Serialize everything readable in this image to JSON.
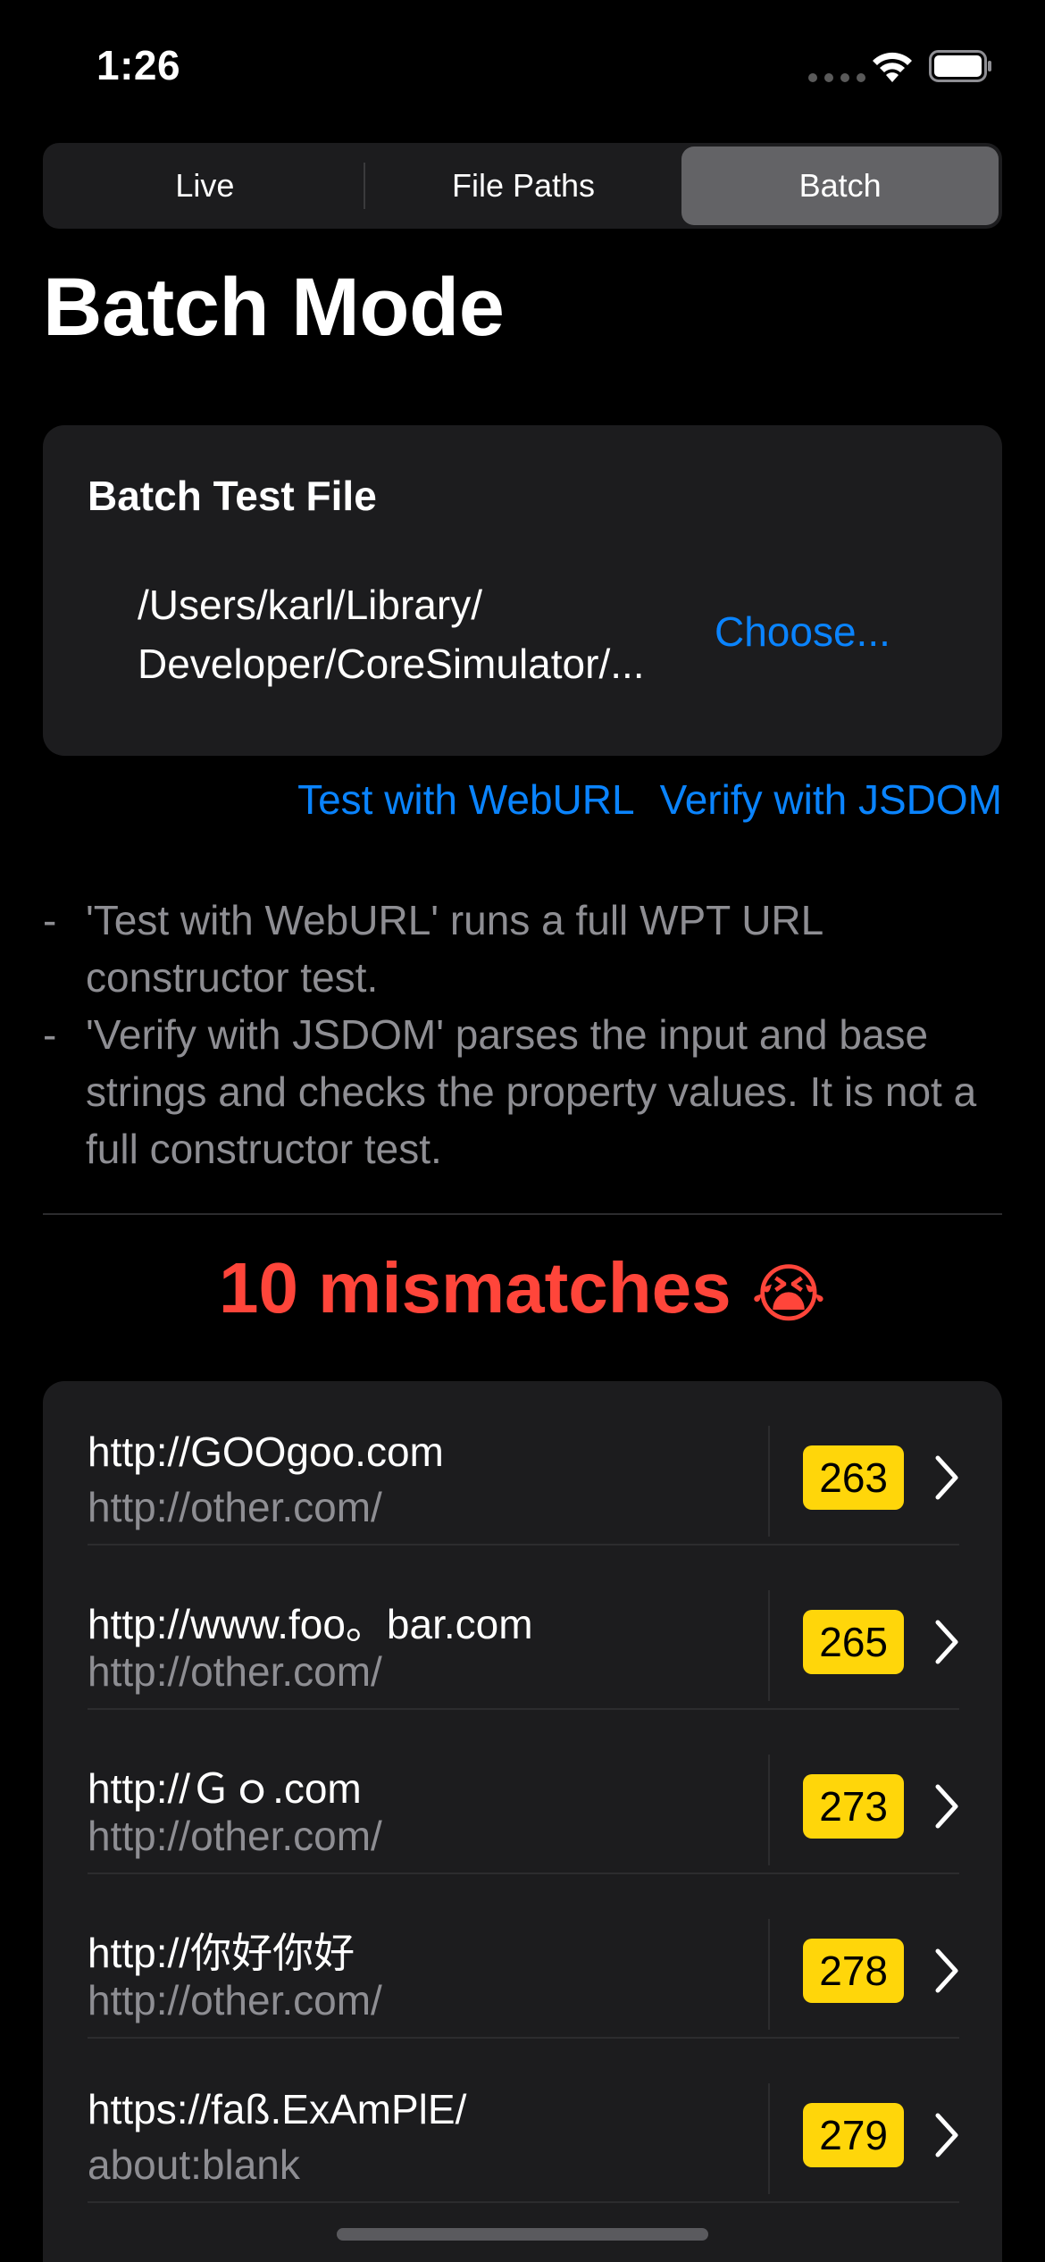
{
  "status_bar": {
    "time": "1:26"
  },
  "tabs": [
    {
      "label": "Live",
      "selected": false
    },
    {
      "label": "File Paths",
      "selected": false
    },
    {
      "label": "Batch",
      "selected": true
    }
  ],
  "page_title": "Batch Mode",
  "batch_card": {
    "title": "Batch Test File",
    "file_path": "/Users/karl/Library/\nDeveloper/CoreSimulator/...",
    "choose_label": "Choose..."
  },
  "actions": {
    "test_webur_label": "Test with WebURL",
    "verify_jsdom_label": "Verify with JSDOM"
  },
  "notes": [
    "'Test with WebURL' runs a full WPT URL constructor test.",
    "'Verify with JSDOM' parses the input and base strings and checks the property values. It is not a full constructor test."
  ],
  "mismatch": {
    "text": "10 mismatches",
    "emoji": "😭"
  },
  "results": [
    {
      "input": "http://GOOgoo.com",
      "base": "http://other.com/",
      "line": "263"
    },
    {
      "input": "http://www.foo。bar.com",
      "base": "http://other.com/",
      "line": "265"
    },
    {
      "input": "http://Ｇｏ.com",
      "base": "http://other.com/",
      "line": "273"
    },
    {
      "input": "http://你好你好",
      "base": "http://other.com/",
      "line": "278"
    },
    {
      "input": "https://faß.ExAmPlE/",
      "base": "about:blank",
      "line": "279"
    }
  ],
  "colors": {
    "accent": "#0a84ff",
    "mismatch": "#ff453a",
    "badge": "#ffd60a"
  }
}
